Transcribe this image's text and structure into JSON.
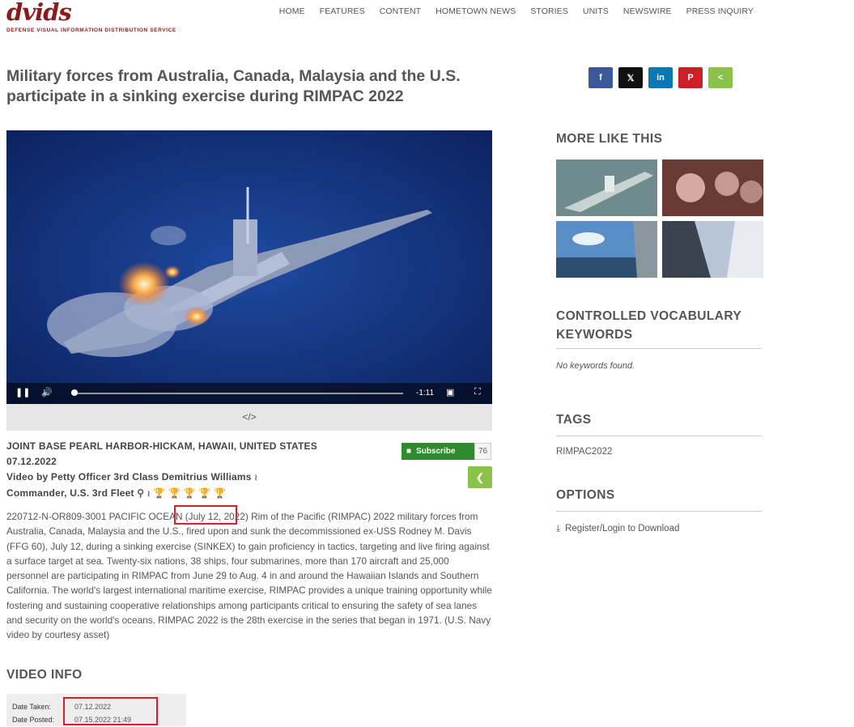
{
  "header": {
    "logo_text": "dvids",
    "logo_sub": "Defense Visual Information Distribution Service",
    "nav": [
      "HOME",
      "FEATURES",
      "CONTENT",
      "HOMETOWN NEWS",
      "STORIES",
      "UNITS",
      "NEWSWIRE",
      "PRESS INQUIRY"
    ]
  },
  "title": "Military forces from Australia, Canada, Malaysia and the U.S. participate in a sinking exercise during RIMPAC 2022",
  "share": {
    "facebook": "f",
    "x": "𝕏",
    "linkedin": "in",
    "pinterest": "P",
    "share": "<"
  },
  "player": {
    "time_remaining": "-1:11",
    "progress": 0.0,
    "embed_label": "</>"
  },
  "meta": {
    "location": "JOINT BASE PEARL HARBOR-HICKAM, HAWAII, UNITED STATES",
    "date": "07.12.2022",
    "byline": "Video by Petty Officer 3rd Class Demitrius Williams",
    "unit": "Commander, U.S. 3rd Fleet",
    "subscribe_label": "Subscribe",
    "subscribe_count": "76"
  },
  "description": {
    "prefix": "220712-N-OR809-3001 PACIFIC OCEAN ",
    "highlight": "(July 12, 2022)",
    "body": " Rim of the Pacific (RIMPAC) 2022 military forces from Australia, Canada, Malaysia and the U.S., fired upon and sunk the decommissioned ex-USS Rodney M. Davis (FFG 60), July 12, during a sinking exercise (SINKEX) to gain proficiency in tactics, targeting and live firing against a surface target at sea. Twenty-six nations, 38 ships, four submarines, more than 170 aircraft and 25,000 personnel are participating in RIMPAC from June 29 to Aug. 4 in and around the Hawaiian Islands and Southern California. The world's largest international maritime exercise, RIMPAC provides a unique training opportunity while fostering and sustaining cooperative relationships among participants critical to ensuring the safety of sea lanes and security on the world's oceans. RIMPAC 2022 is the 28th exercise in the series that began in 1971. (U.S. Navy video by courtesy asset)"
  },
  "video_info": {
    "heading": "VIDEO INFO",
    "date_taken_label": "Date Taken:",
    "date_taken": "07.12.2022",
    "date_posted_label": "Date Posted:",
    "date_posted": "07.15.2022 21:49"
  },
  "sidebar": {
    "more_like_this": "MORE LIKE THIS",
    "keywords_heading": "CONTROLLED VOCABULARY KEYWORDS",
    "keywords_empty": "No keywords found.",
    "tags_heading": "TAGS",
    "tags": [
      "RIMPAC2022"
    ],
    "options_heading": "OPTIONS",
    "download_label": "Register/Login to Download"
  }
}
